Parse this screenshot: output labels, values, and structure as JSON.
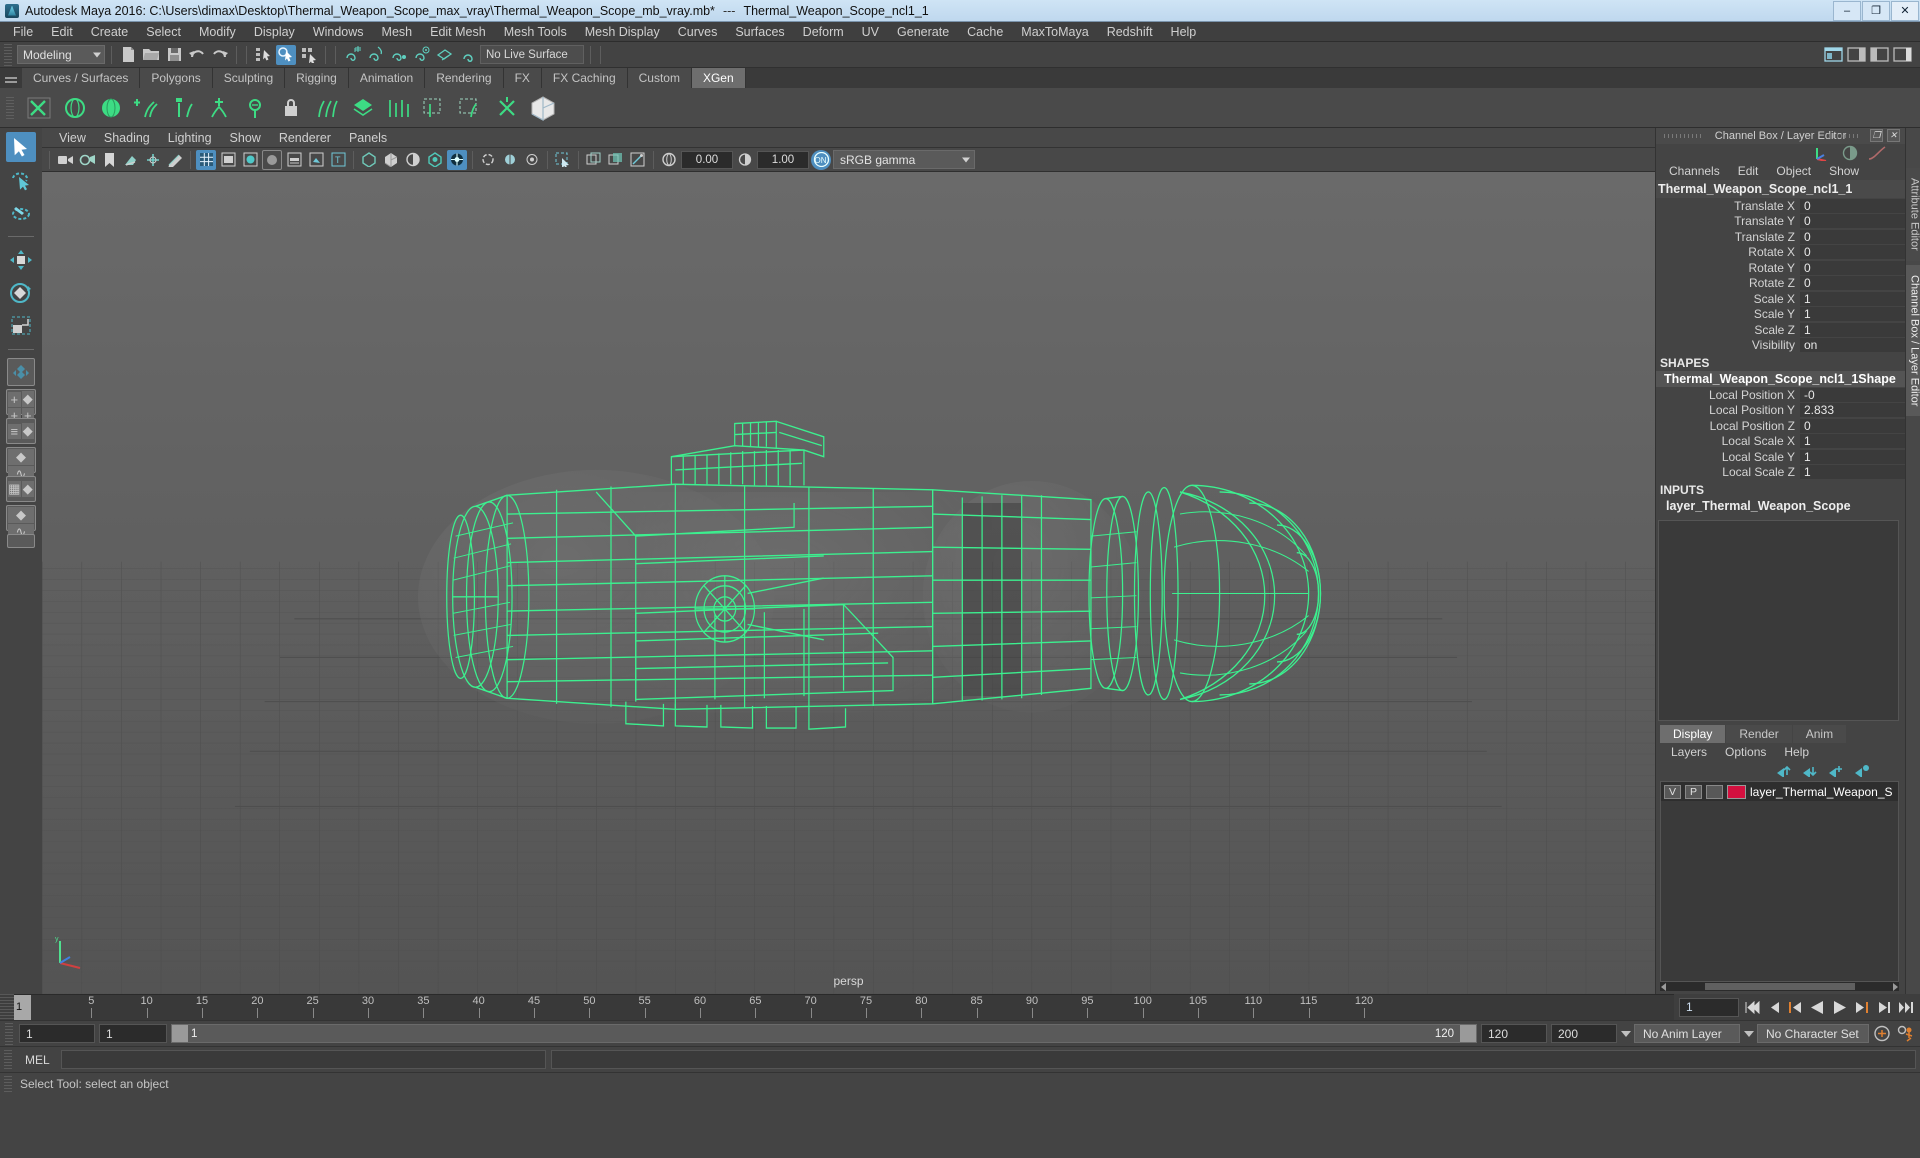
{
  "window": {
    "title": "Autodesk Maya 2016: C:\\Users\\dimax\\Desktop\\Thermal_Weapon_Scope_max_vray\\Thermal_Weapon_Scope_mb_vray.mb*",
    "separator": "---",
    "selection_name": "Thermal_Weapon_Scope_ncl1_1",
    "minimize": "–",
    "maximize": "❐",
    "close": "✕"
  },
  "menubar": {
    "items": [
      "File",
      "Edit",
      "Create",
      "Select",
      "Modify",
      "Display",
      "Windows",
      "Mesh",
      "Edit Mesh",
      "Mesh Tools",
      "Mesh Display",
      "Curves",
      "Surfaces",
      "Deform",
      "UV",
      "Generate",
      "Cache",
      "MaxToMaya",
      "Redshift",
      "Help"
    ]
  },
  "statusline": {
    "mode": "Modeling",
    "live_surface": "No Live Surface"
  },
  "shelf": {
    "tabs": [
      "Curves / Surfaces",
      "Polygons",
      "Sculpting",
      "Rigging",
      "Animation",
      "Rendering",
      "FX",
      "FX Caching",
      "Custom",
      "XGen"
    ],
    "active_tab": "XGen"
  },
  "viewport": {
    "menus": [
      "View",
      "Shading",
      "Lighting",
      "Show",
      "Renderer",
      "Panels"
    ],
    "exposure": "0.00",
    "gamma": "1.00",
    "color_profile": "sRGB gamma",
    "camera_label": "persp",
    "wireframe_color": "#3cf08f",
    "background_color": "#5a5a5a"
  },
  "channelbox": {
    "panel_title": "Channel Box / Layer Editor",
    "menus": [
      "Channels",
      "Edit",
      "Object",
      "Show"
    ],
    "node_name": "Thermal_Weapon_Scope_ncl1_1",
    "transform_attrs": [
      {
        "label": "Translate X",
        "value": "0"
      },
      {
        "label": "Translate Y",
        "value": "0"
      },
      {
        "label": "Translate Z",
        "value": "0"
      },
      {
        "label": "Rotate X",
        "value": "0"
      },
      {
        "label": "Rotate Y",
        "value": "0"
      },
      {
        "label": "Rotate Z",
        "value": "0"
      },
      {
        "label": "Scale X",
        "value": "1"
      },
      {
        "label": "Scale Y",
        "value": "1"
      },
      {
        "label": "Scale Z",
        "value": "1"
      },
      {
        "label": "Visibility",
        "value": "on"
      }
    ],
    "shapes_header": "SHAPES",
    "shape_name": "Thermal_Weapon_Scope_ncl1_1Shape",
    "shape_attrs": [
      {
        "label": "Local Position X",
        "value": "-0"
      },
      {
        "label": "Local Position Y",
        "value": "2.833"
      },
      {
        "label": "Local Position Z",
        "value": "0"
      },
      {
        "label": "Local Scale X",
        "value": "1"
      },
      {
        "label": "Local Scale Y",
        "value": "1"
      },
      {
        "label": "Local Scale Z",
        "value": "1"
      }
    ],
    "inputs_header": "INPUTS",
    "input_name": "layer_Thermal_Weapon_Scope"
  },
  "layereditor": {
    "tabs": [
      "Display",
      "Render",
      "Anim"
    ],
    "active_tab": "Display",
    "menus": [
      "Layers",
      "Options",
      "Help"
    ],
    "layers": [
      {
        "visibility": "V",
        "playback": "P",
        "shading": "",
        "color": "#d4103f",
        "name": "layer_Thermal_Weapon_S"
      }
    ]
  },
  "sidetabs": {
    "items": [
      "Attribute Editor",
      "Channel Box / Layer Editor"
    ],
    "active": "Channel Box / Layer Editor"
  },
  "timeline": {
    "current_frame": "1",
    "ticks": [
      "5",
      "10",
      "15",
      "20",
      "25",
      "30",
      "35",
      "40",
      "45",
      "50",
      "55",
      "60",
      "65",
      "70",
      "75",
      "80",
      "85",
      "90",
      "95",
      "100",
      "105",
      "110",
      "115",
      "120"
    ],
    "playback_start": "1",
    "range_start": "1",
    "range_slider_left": "1",
    "range_slider_right": "120",
    "playback_end": "120",
    "range_end": "200",
    "anim_layer": "No Anim Layer",
    "character_set": "No Character Set"
  },
  "commandline": {
    "prompt": "MEL",
    "value": "",
    "placeholder": ""
  },
  "helpline": {
    "text": "Select Tool: select an object"
  }
}
